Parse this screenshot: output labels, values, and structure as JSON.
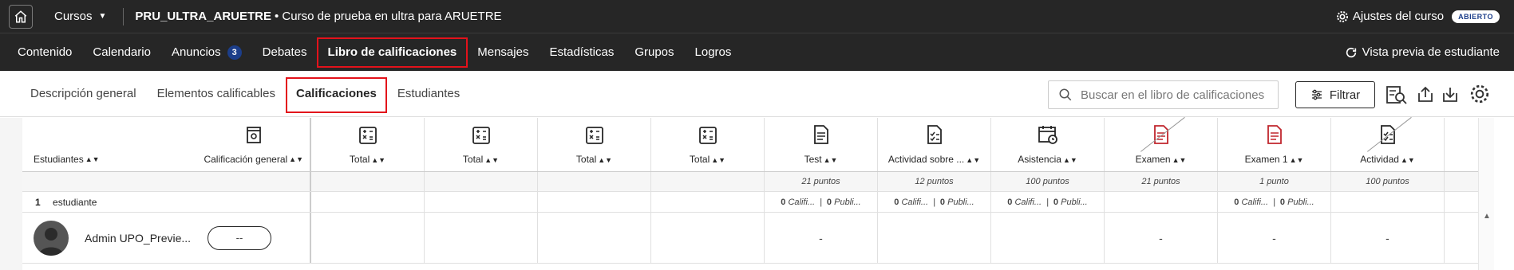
{
  "topbar": {
    "courses_label": "Cursos",
    "course_code": "PRU_ULTRA_ARUETRE",
    "course_name": "• Curso de prueba en ultra para ARUETRE",
    "settings_label": "Ajustes del curso",
    "status_badge": "ABIERTO"
  },
  "nav": {
    "items": [
      {
        "label": "Contenido"
      },
      {
        "label": "Calendario"
      },
      {
        "label": "Anuncios",
        "badge": "3"
      },
      {
        "label": "Debates"
      },
      {
        "label": "Libro de calificaciones"
      },
      {
        "label": "Mensajes"
      },
      {
        "label": "Estadísticas"
      },
      {
        "label": "Grupos"
      },
      {
        "label": "Logros"
      }
    ],
    "preview_label": "Vista previa de estudiante"
  },
  "tabs": [
    "Descripción general",
    "Elementos calificables",
    "Calificaciones",
    "Estudiantes"
  ],
  "search": {
    "placeholder": "Buscar en el libro de calificaciones"
  },
  "filter_label": "Filtrar",
  "grid": {
    "students_header": "Estudiantes",
    "overall_header": "Calificación general",
    "columns": [
      {
        "label": "Total",
        "points": "",
        "counts": ""
      },
      {
        "label": "Total",
        "points": "",
        "counts": ""
      },
      {
        "label": "Total",
        "points": "",
        "counts": ""
      },
      {
        "label": "Total",
        "points": "",
        "counts": ""
      },
      {
        "label": "Test",
        "points": "21 puntos",
        "graded": "0",
        "graded_label": "Califi...",
        "published": "0",
        "published_label": "Publi..."
      },
      {
        "label": "Actividad sobre ...",
        "points": "12 puntos",
        "graded": "0",
        "graded_label": "Califi...",
        "published": "0",
        "published_label": "Publi..."
      },
      {
        "label": "Asistencia",
        "points": "100 puntos",
        "graded": "0",
        "graded_label": "Califi...",
        "published": "0",
        "published_label": "Publi..."
      },
      {
        "label": "Examen",
        "points": "21 puntos",
        "counts": ""
      },
      {
        "label": "Examen 1",
        "points": "1 punto",
        "graded": "0",
        "graded_label": "Califi...",
        "published": "0",
        "published_label": "Publi..."
      },
      {
        "label": "Actividad",
        "points": "100 puntos",
        "counts": ""
      }
    ],
    "student_count_num": "1",
    "student_count_label": "estudiante",
    "student": {
      "name": "Admin UPO_Previe...",
      "overall": "--",
      "cells": [
        "",
        "",
        "",
        "",
        "-",
        "",
        "",
        "-",
        "-",
        "-"
      ]
    }
  }
}
